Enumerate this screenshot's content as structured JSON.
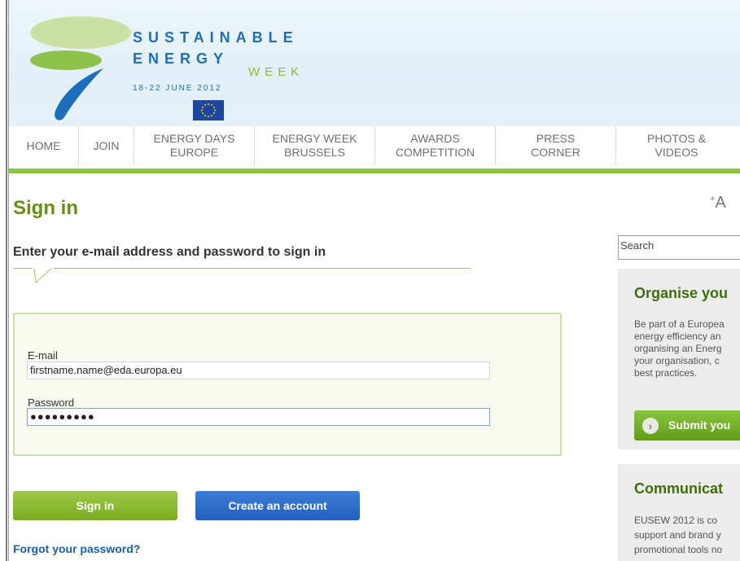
{
  "header": {
    "brand_line_1": "SUSTAINABLE",
    "brand_line_2": "ENERGY",
    "brand_line_3": "WEEK",
    "dates": "18-22 JUNE 2012"
  },
  "nav": {
    "items": [
      {
        "label": "HOME"
      },
      {
        "label": "JOIN"
      },
      {
        "label": "ENERGY DAYS\nEUROPE"
      },
      {
        "label": "ENERGY WEEK\nBRUSSELS"
      },
      {
        "label": "AWARDS\nCOMPETITION"
      },
      {
        "label": "PRESS\nCORNER"
      },
      {
        "label": "PHOTOS &\nVIDEOS"
      }
    ]
  },
  "main": {
    "title": "Sign in",
    "subtitle": "Enter your e-mail address and password to sign in",
    "email_label": "E-mail",
    "email_value": "firstname.name@eda.europa.eu",
    "password_label": "Password",
    "password_value": "●●●●●●●●●",
    "signin_button": "Sign in",
    "create_button": "Create an account",
    "forgot_link": "Forgot your password?"
  },
  "sidebar": {
    "font_size_icon": "font-size-increase-icon",
    "search_placeholder": "Search",
    "panel_1": {
      "title": "Organise you",
      "lines": [
        "Be part of a Europea",
        "energy efficiency an",
        "organising an Energ",
        "your organisation, c",
        "best practices."
      ],
      "button": "Submit you"
    },
    "panel_2": {
      "title": "Communicat",
      "lines": [
        "EUSEW 2012 is co",
        "support and brand y",
        "promotional tools no"
      ]
    }
  },
  "colors": {
    "brand_blue": "#1c6fb6",
    "brand_green": "#8cc63f",
    "title_green": "#6a8f15",
    "button_blue": "#2e6fcf"
  }
}
